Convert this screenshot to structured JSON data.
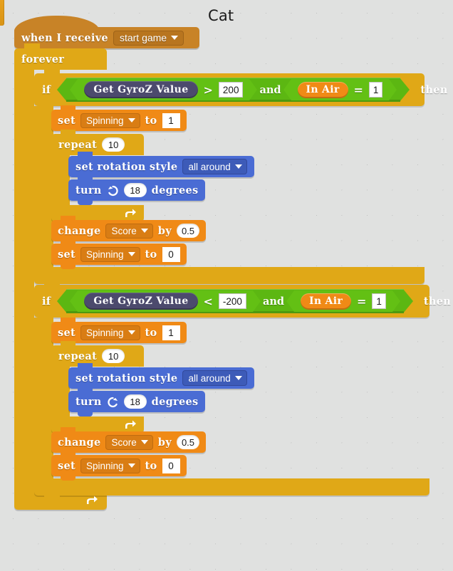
{
  "sprite": {
    "name": "Cat"
  },
  "script": {
    "hat": {
      "label": "when I receive",
      "message": "start game"
    },
    "forever": {
      "label": "forever"
    },
    "branches": [
      {
        "if_label": "if",
        "then_label": "then",
        "condition": {
          "left": {
            "reporter": "Get GyroZ Value",
            "type": "sensing-reporter"
          },
          "operator_1": ">",
          "value_1": "200",
          "conjunction": "and",
          "right": {
            "reporter": "In Air",
            "type": "variable-reporter"
          },
          "operator_2": "=",
          "value_2": "1"
        },
        "body": {
          "set_spinning_on": {
            "label": "set",
            "variable": "Spinning",
            "to_label": "to",
            "value": "1"
          },
          "repeat": {
            "label": "repeat",
            "times": "10"
          },
          "set_rotation_style": {
            "label": "set rotation style",
            "style": "all around"
          },
          "turn": {
            "label": "turn",
            "direction_icon": "turn-counterclockwise-icon",
            "degrees": "18",
            "degrees_label": "degrees"
          },
          "change_score": {
            "label": "change",
            "variable": "Score",
            "by_label": "by",
            "value": "0.5"
          },
          "set_spinning_off": {
            "label": "set",
            "variable": "Spinning",
            "to_label": "to",
            "value": "0"
          }
        }
      },
      {
        "if_label": "if",
        "then_label": "then",
        "condition": {
          "left": {
            "reporter": "Get GyroZ Value",
            "type": "sensing-reporter"
          },
          "operator_1": "<",
          "value_1": "-200",
          "conjunction": "and",
          "right": {
            "reporter": "In Air",
            "type": "variable-reporter"
          },
          "operator_2": "=",
          "value_2": "1"
        },
        "body": {
          "set_spinning_on": {
            "label": "set",
            "variable": "Spinning",
            "to_label": "to",
            "value": "1"
          },
          "repeat": {
            "label": "repeat",
            "times": "10"
          },
          "set_rotation_style": {
            "label": "set rotation style",
            "style": "all around"
          },
          "turn": {
            "label": "turn",
            "direction_icon": "turn-clockwise-icon",
            "degrees": "18",
            "degrees_label": "degrees"
          },
          "change_score": {
            "label": "change",
            "variable": "Score",
            "by_label": "by",
            "value": "0.5"
          },
          "set_spinning_off": {
            "label": "set",
            "variable": "Spinning",
            "to_label": "to",
            "value": "0"
          }
        }
      }
    ]
  },
  "colors": {
    "background": "#e0e1e0",
    "control": "#e0a817",
    "event_hat": "#c88327",
    "data_orange": "#f08a16",
    "motion_blue": "#4a6cd4",
    "operator_green": "#5cb712",
    "sensing_dark": "#4c4a6d"
  }
}
